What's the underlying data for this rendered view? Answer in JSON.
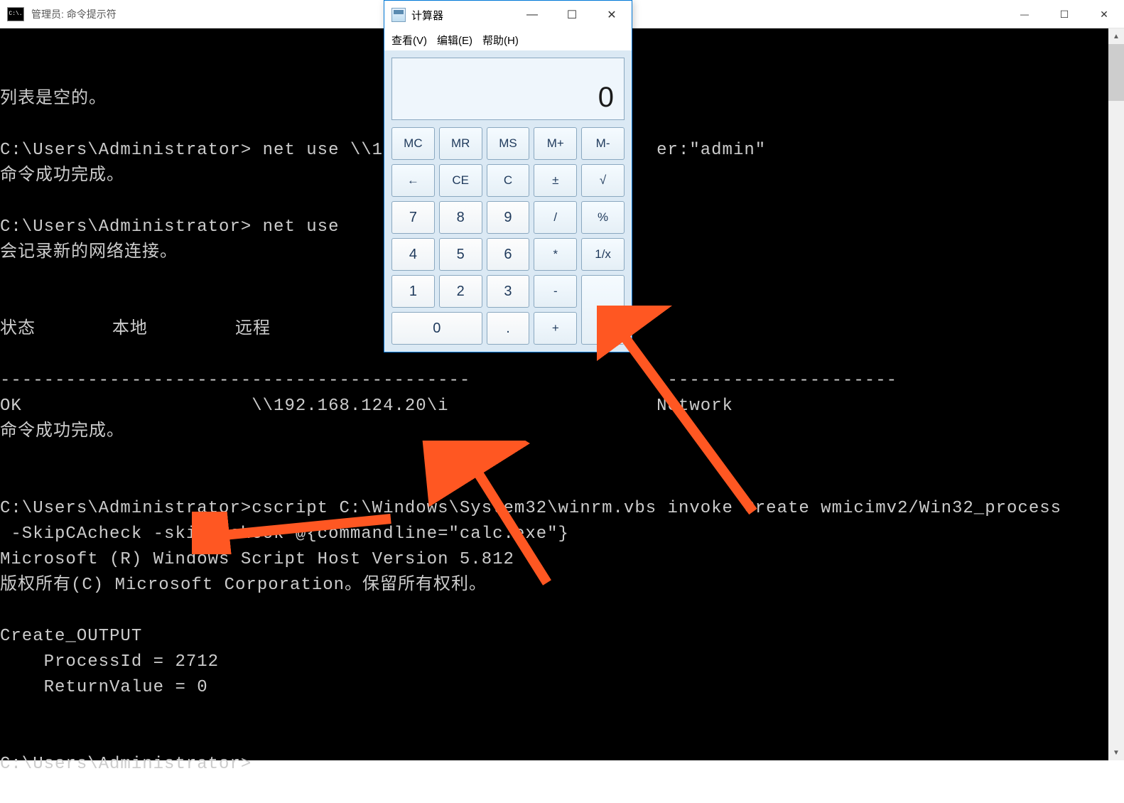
{
  "main_window": {
    "title": "管理员: 命令提示符",
    "icon_text": "C:\\."
  },
  "terminal_lines": [
    "列表是空的。",
    "",
    "C:\\Users\\Administrator> net use \\\\192.168                   er:\"admin\"",
    "命令成功完成。",
    "",
    "C:\\Users\\Administrator> net use",
    "会记录新的网络连接。",
    "",
    "",
    "状态       本地        远程",
    "",
    "-------------------------------------------                  ---------------------",
    "OK                     \\\\192.168.124.20\\i                   Network",
    "命令成功完成。",
    "",
    "",
    "C:\\Users\\Administrator>cscript C:\\Windows\\System32\\winrm.vbs invoke Create wmicimv2/Win32_process",
    " -SkipCAcheck -skipCNcheck @{commandline=\"calc.exe\"}",
    "Microsoft (R) Windows Script Host Version 5.812",
    "版权所有(C) Microsoft Corporation。保留所有权利。",
    "",
    "Create_OUTPUT",
    "    ProcessId = 2712",
    "    ReturnValue = 0",
    "",
    "",
    "C:\\Users\\Administrator>"
  ],
  "calculator": {
    "title": "计算器",
    "menu": {
      "view": "查看(V)",
      "edit": "编辑(E)",
      "help": "帮助(H)"
    },
    "display": "0",
    "buttons": {
      "mc": "MC",
      "mr": "MR",
      "ms": "MS",
      "mplus": "M+",
      "mminus": "M-",
      "back": "←",
      "ce": "CE",
      "c": "C",
      "pm": "±",
      "sqrt": "√",
      "b7": "7",
      "b8": "8",
      "b9": "9",
      "div": "/",
      "pct": "%",
      "b4": "4",
      "b5": "5",
      "b6": "6",
      "mul": "*",
      "inv": "1/x",
      "b1": "1",
      "b2": "2",
      "b3": "3",
      "sub": "-",
      "eq": "=",
      "b0": "0",
      "dot": ".",
      "add": "+"
    }
  }
}
